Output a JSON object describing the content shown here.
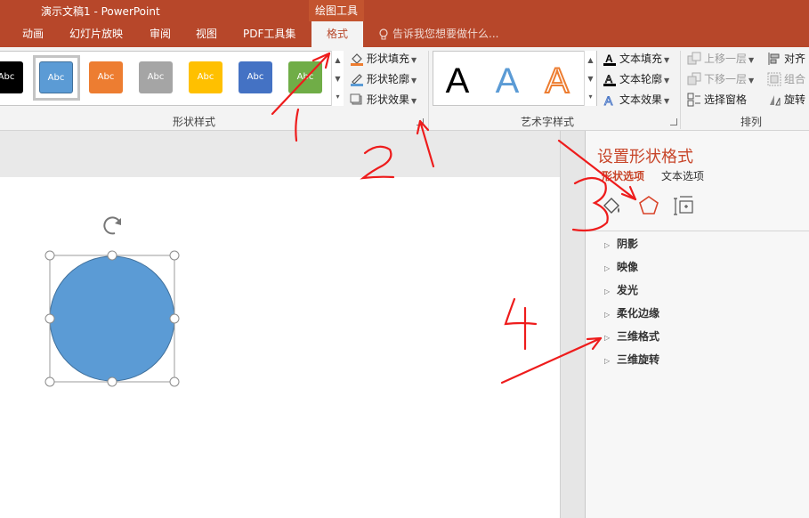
{
  "window": {
    "title": "演示文稿1 - PowerPoint",
    "context_tab_group": "绘图工具"
  },
  "tabs": [
    "动画",
    "幻灯片放映",
    "审阅",
    "视图",
    "PDF工具集",
    "格式"
  ],
  "active_tab": "格式",
  "tell_me": {
    "placeholder": "告诉我您想要做什么...",
    "icon": "lightbulb-icon"
  },
  "ribbon": {
    "shape_styles": {
      "label": "形状样式",
      "items": [
        {
          "label": "Abc",
          "color": "#000000"
        },
        {
          "label": "Abc",
          "color": "#5b9bd5",
          "selected": true
        },
        {
          "label": "Abc",
          "color": "#ed7d31"
        },
        {
          "label": "Abc",
          "color": "#a5a5a5"
        },
        {
          "label": "Abc",
          "color": "#ffc000"
        },
        {
          "label": "Abc",
          "color": "#4472c4"
        },
        {
          "label": "Abc",
          "color": "#70ad47"
        }
      ],
      "commands": {
        "fill": "形状填充",
        "outline": "形状轮廓",
        "effects": "形状效果"
      }
    },
    "wordart_styles": {
      "label": "艺术字样式",
      "samples": [
        {
          "letter": "A",
          "style": "black"
        },
        {
          "letter": "A",
          "style": "blue"
        },
        {
          "letter": "A",
          "style": "orange-outline"
        }
      ],
      "commands": {
        "fill": "文本填充",
        "outline": "文本轮廓",
        "effects": "文本效果"
      }
    },
    "arrange": {
      "label": "排列",
      "commands": {
        "bring_forward": "上移一层",
        "send_backward": "下移一层",
        "selection_pane": "选择窗格",
        "align": "对齐",
        "group": "组合",
        "rotate": "旋转"
      }
    }
  },
  "format_pane": {
    "title": "设置形状格式",
    "tabs": [
      "形状选项",
      "文本选项"
    ],
    "active_tab": "形状选项",
    "icons": [
      "fill-line-icon",
      "effects-pentagon-icon",
      "size-properties-icon"
    ],
    "active_icon": "effects-pentagon-icon",
    "sections": [
      "阴影",
      "映像",
      "发光",
      "柔化边缘",
      "三维格式",
      "三维旋转"
    ]
  },
  "shape": {
    "type": "circle",
    "fill": "#5b9bd5",
    "outline": "#41719c"
  },
  "annotations": {
    "color": "#ee1c1c",
    "numbers": [
      "1",
      "2",
      "3",
      "4"
    ]
  }
}
